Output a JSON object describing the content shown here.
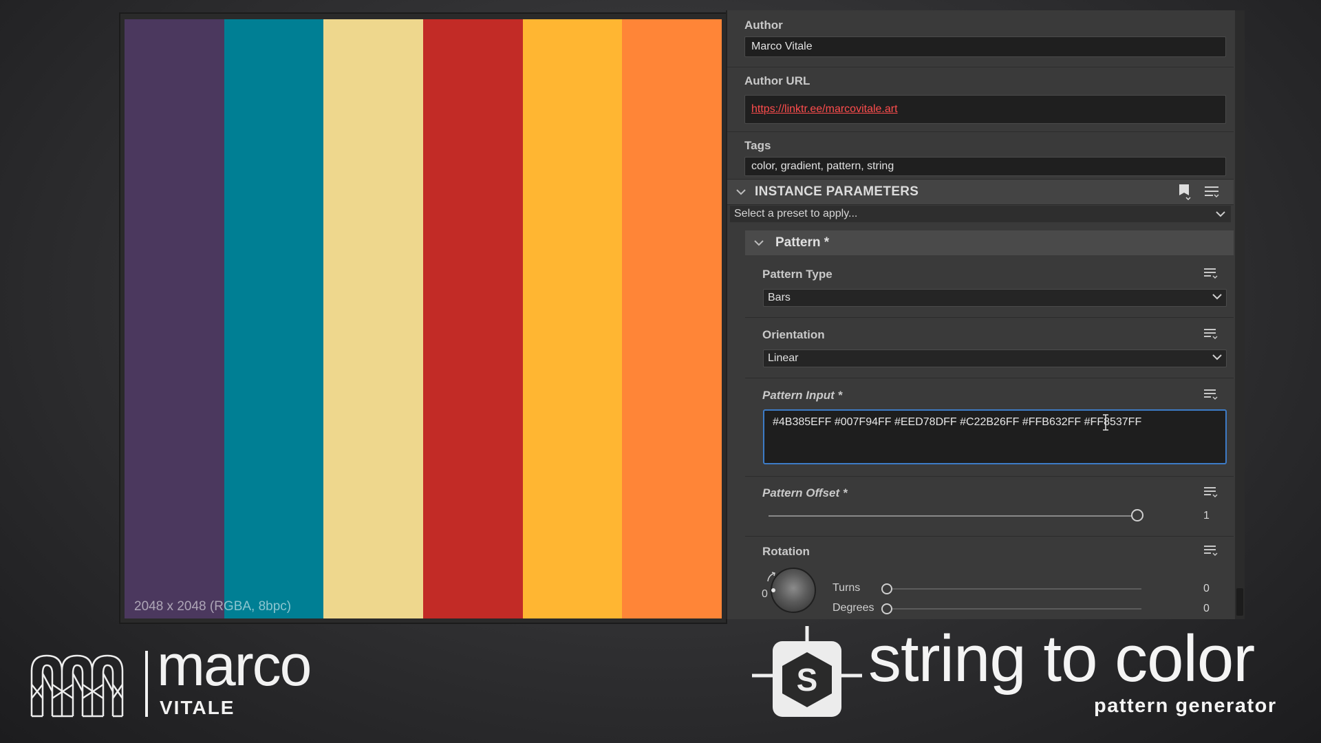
{
  "viewport": {
    "bar_colors": [
      "#4B385E",
      "#007F94",
      "#EED78D",
      "#C22B26",
      "#FFB632",
      "#FF8537"
    ],
    "resolution_label": "2048 x 2048 (RGBA, 8bpc)"
  },
  "panel": {
    "author": {
      "label": "Author",
      "value": "Marco Vitale"
    },
    "author_url": {
      "label": "Author URL",
      "value": "https://linktr.ee/marcovitale.art"
    },
    "tags": {
      "label": "Tags",
      "value": "color, gradient, pattern, string"
    },
    "instance_parameters": {
      "title": "INSTANCE PARAMETERS",
      "preset_placeholder": "Select a preset to apply..."
    },
    "pattern_group": {
      "title": "Pattern *",
      "pattern_type": {
        "label": "Pattern Type",
        "value": "Bars"
      },
      "orientation": {
        "label": "Orientation",
        "value": "Linear"
      },
      "pattern_input": {
        "label": "Pattern Input *",
        "value": "#4B385EFF #007F94FF #EED78DFF #C22B26FF #FFB632FF #FF8537FF"
      },
      "pattern_offset": {
        "label": "Pattern Offset *",
        "value": "1",
        "fraction": 1.0
      },
      "rotation": {
        "label": "Rotation",
        "dial_value": "0",
        "turns": {
          "label": "Turns",
          "value": "0",
          "fraction": 0
        },
        "degrees": {
          "label": "Degrees",
          "value": "0",
          "fraction": 0
        }
      }
    }
  },
  "branding": {
    "author_name": "marco",
    "author_surname": "VITALE",
    "product_title": "string to color",
    "product_subtitle": "pattern generator"
  },
  "icons": [
    "chevron-down-icon",
    "preset-save-icon",
    "menu-list-icon",
    "text-cursor-icon",
    "monogram-logo",
    "substance-logo"
  ]
}
